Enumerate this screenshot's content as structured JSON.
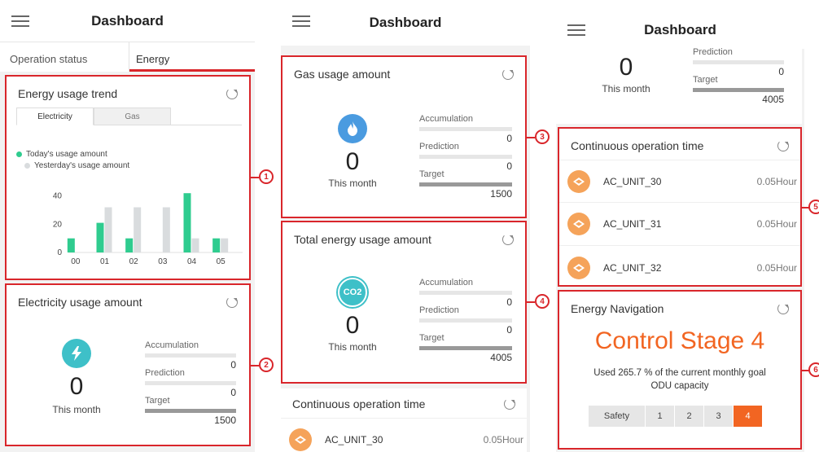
{
  "header": {
    "title": "Dashboard"
  },
  "tabs": [
    {
      "label": "Operation status"
    },
    {
      "label": "Energy"
    }
  ],
  "energy_trend": {
    "title": "Energy usage trend",
    "tab_electricity": "Electricity",
    "tab_gas": "Gas",
    "legend_today": "Today's usage amount",
    "legend_yesterday": "Yesterday's usage amount",
    "colors": {
      "today": "#2fcc8f",
      "yesterday": "#d9dcde"
    }
  },
  "chart_data": {
    "type": "bar",
    "categories": [
      "00",
      "01",
      "02",
      "03",
      "04",
      "05"
    ],
    "series": [
      {
        "name": "Today's usage amount",
        "values": [
          10,
          21,
          10,
          0,
          42,
          10
        ]
      },
      {
        "name": "Yesterday's usage amount",
        "values": [
          0,
          32,
          32,
          32,
          10,
          10
        ]
      }
    ],
    "ylim": [
      0,
      45
    ],
    "yticks": [
      "0",
      "20",
      "40"
    ],
    "grid": false,
    "legend": "top-left"
  },
  "electricity": {
    "title": "Electricity usage amount",
    "value": "0",
    "month_label": "This month",
    "accumulation_label": "Accumulation",
    "accumulation_value": "0",
    "prediction_label": "Prediction",
    "prediction_value": "0",
    "target_label": "Target",
    "target_value": "1500",
    "icon": "lightning-icon"
  },
  "gas": {
    "title": "Gas usage amount",
    "value": "0",
    "month_label": "This month",
    "accumulation_label": "Accumulation",
    "accumulation_value": "0",
    "prediction_label": "Prediction",
    "prediction_value": "0",
    "target_label": "Target",
    "target_value": "1500",
    "icon": "flame-icon"
  },
  "total": {
    "title": "Total energy usage amount",
    "value": "0",
    "month_label": "This month",
    "accumulation_label": "Accumulation",
    "accumulation_value": "0",
    "prediction_label": "Prediction",
    "prediction_value": "0",
    "target_label": "Target",
    "target_value": "4005",
    "icon_text": "CO2"
  },
  "top_partial": {
    "value": "0",
    "month_label": "This month",
    "prediction_label": "Prediction",
    "prediction_value": "0",
    "target_label": "Target",
    "target_value": "4005"
  },
  "continuous": {
    "title": "Continuous operation time",
    "units": [
      {
        "name": "AC_UNIT_30",
        "hours": "0.05Hour"
      },
      {
        "name": "AC_UNIT_31",
        "hours": "0.05Hour"
      },
      {
        "name": "AC_UNIT_32",
        "hours": "0.05Hour"
      }
    ]
  },
  "navigation": {
    "title": "Energy Navigation",
    "stage": "Control Stage 4",
    "desc_line1": "Used 265.7 % of the current monthly goal",
    "desc_line2": "ODU capacity",
    "buttons": [
      "Safety",
      "1",
      "2",
      "3",
      "4"
    ],
    "active_index": 4,
    "accent": "#f26522"
  },
  "callouts": [
    "1",
    "2",
    "3",
    "4",
    "5",
    "6"
  ],
  "colors": {
    "outline": "#d9262b",
    "gas_icon": "#4a9be0",
    "elec_icon": "#3ec0c8"
  }
}
